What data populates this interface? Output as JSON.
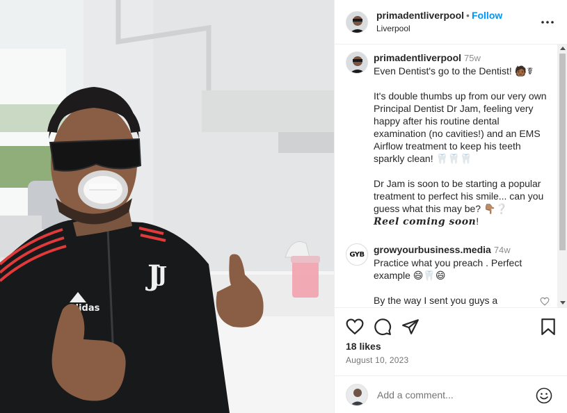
{
  "post": {
    "username": "primadentliverpool",
    "follow_label": "Follow",
    "location": "Liverpool",
    "more_icon": "more-options-icon"
  },
  "caption": {
    "username": "primadentliverpool",
    "time": "75w",
    "line1": "Even Dentist's go to the Dentist! 🧑🏾☤",
    "para2": "It's double thumbs up from our very own Principal Dentist Dr Jam, feeling very happy after his routine dental examination (no cavities!) and an EMS Airflow treatment to keep his teeth sparkly clean! 🦷🦷🦷",
    "para3": "Dr Jam is soon to be starting a popular treatment to perfect his smile... can you guess what this may be? 👇🏽❔",
    "para4": "Reel coming soon",
    "para4_end": "!"
  },
  "comment1": {
    "avatar_text": "GYB",
    "username": "growyourbusiness.media",
    "time": "74w",
    "line1": "Practice what you preach . Perfect example 😄🦷😄",
    "line2": "By the way I sent you guys a"
  },
  "actions": {
    "likes": "18 likes",
    "date": "August 10, 2023"
  },
  "composer": {
    "placeholder": "Add a comment..."
  },
  "colors": {
    "accent": "#0095f6",
    "text": "#262626",
    "muted": "#737373"
  }
}
